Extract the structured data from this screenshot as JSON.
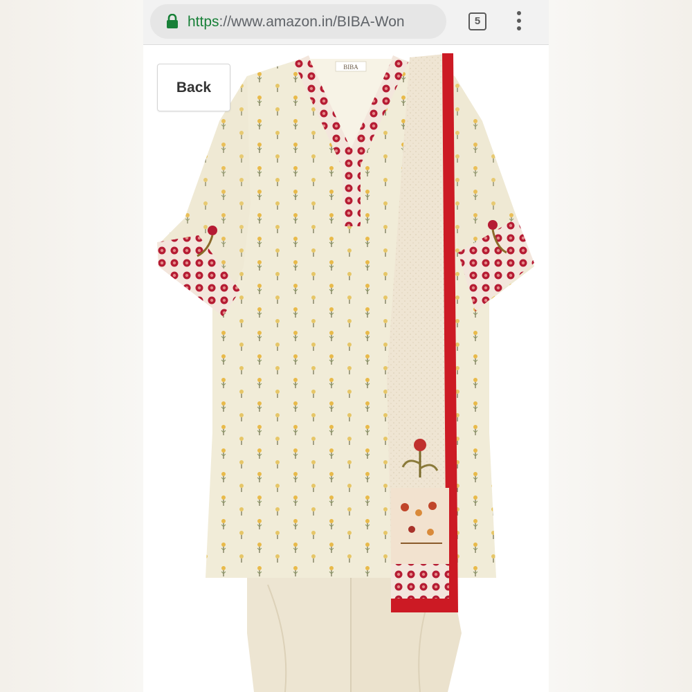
{
  "browser": {
    "url_scheme": "https",
    "url_rest": "://www.amazon.in/BIBA-Won",
    "tab_count": "5"
  },
  "page": {
    "back_label": "Back",
    "product_image": {
      "description_icon": "kurta-suit-image",
      "brand_tag": "BIBA"
    }
  },
  "colors": {
    "url_green": "#188038",
    "kurta_cream": "#f1ecd8",
    "embroidery_red": "#b51b33",
    "dupatta_border": "#cc1a24"
  }
}
